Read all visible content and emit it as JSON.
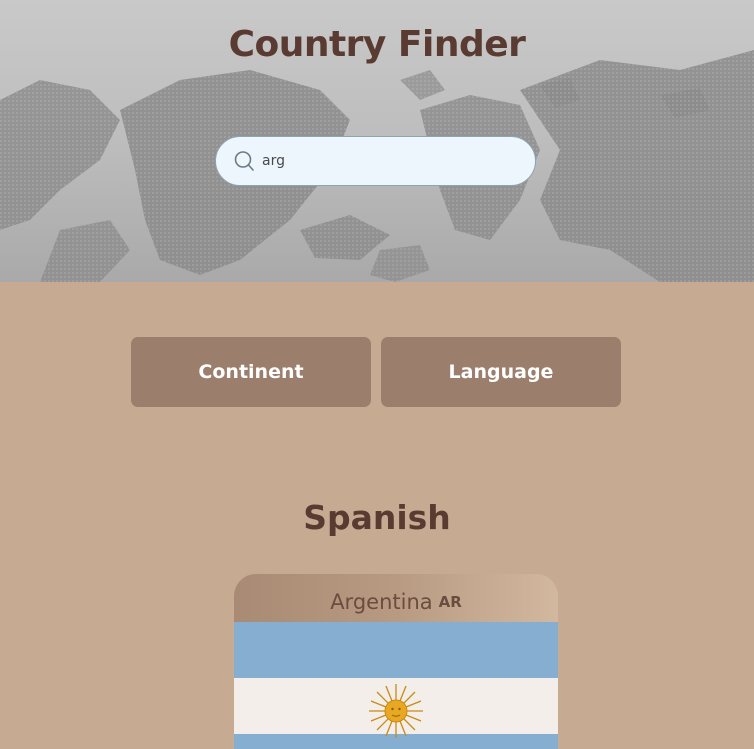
{
  "header": {
    "title": "Country Finder"
  },
  "search": {
    "value": "arg",
    "icon": "search-icon"
  },
  "filters": {
    "continent_label": "Continent",
    "language_label": "Language"
  },
  "results": {
    "group_title": "Spanish",
    "countries": [
      {
        "name": "Argentina",
        "code": "AR",
        "flag_colors": {
          "blue": "#86aed0",
          "white": "#f3eee9",
          "sun": "#e8a824"
        }
      }
    ]
  },
  "colors": {
    "background": "#c6ab92",
    "title": "#5a3b31",
    "button": "#9b7f6c",
    "search_bg": "#eef6fd"
  }
}
